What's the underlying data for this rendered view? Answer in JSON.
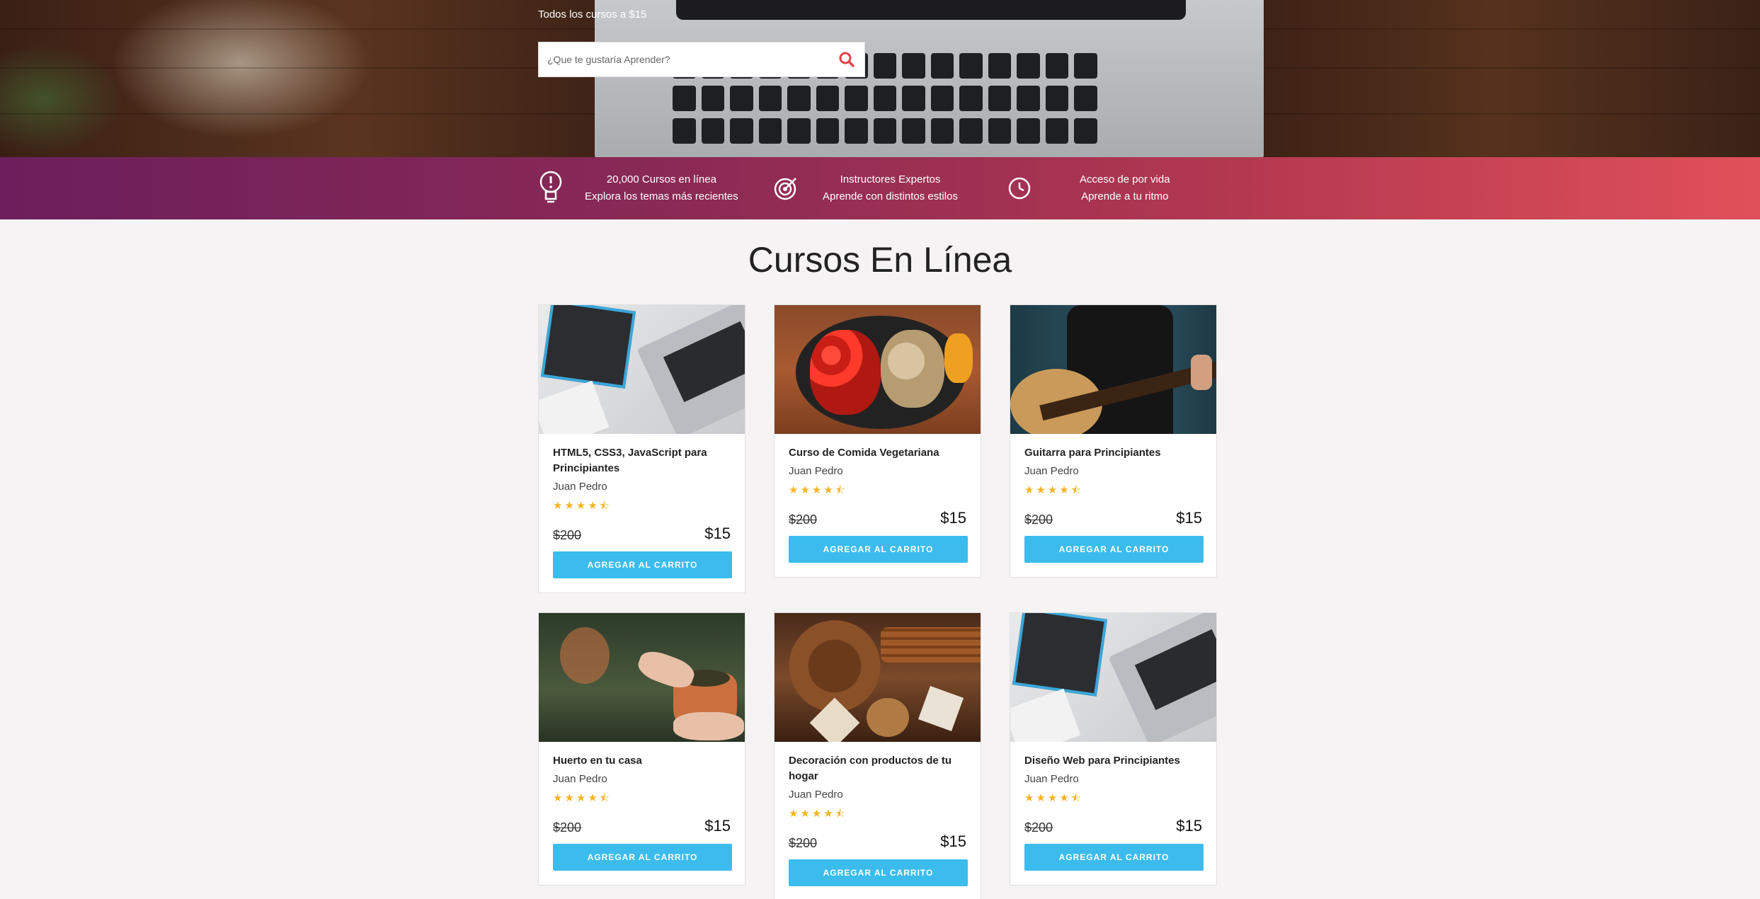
{
  "hero": {
    "promo": "Todos los cursos a $15",
    "search_placeholder": "¿Que te gustaría Aprender?"
  },
  "features": [
    {
      "icon": "lightbulb-icon",
      "line1": "20,000 Cursos en línea",
      "line2": "Explora los temas más recientes"
    },
    {
      "icon": "target-icon",
      "line1": "Instructores Expertos",
      "line2": "Aprende con distintos estilos"
    },
    {
      "icon": "clock-icon",
      "line1": "Acceso de por vida",
      "line2": "Aprende a tu ritmo"
    }
  ],
  "section_title": "Cursos En Línea",
  "colors": {
    "button": "#3bbced",
    "stars": "#f5b324",
    "bar_start": "#6c1f5c",
    "bar_end": "#e0505a",
    "search_icon": "#e2434b"
  },
  "courses": [
    {
      "image": "laptop-notebook-image",
      "title": "HTML5, CSS3, JavaScript para Principiantes",
      "author": "Juan Pedro",
      "rating": 4.5,
      "old_price": "$200",
      "price": "$15",
      "button": "AGREGAR AL CARRITO"
    },
    {
      "image": "vegetables-pan-image",
      "title": "Curso de Comida Vegetariana",
      "author": "Juan Pedro",
      "rating": 4.5,
      "old_price": "$200",
      "price": "$15",
      "button": "AGREGAR AL CARRITO"
    },
    {
      "image": "guitar-player-image",
      "title": "Guitarra para Principiantes",
      "author": "Juan Pedro",
      "rating": 4.5,
      "old_price": "$200",
      "price": "$15",
      "button": "AGREGAR AL CARRITO"
    },
    {
      "image": "plant-pot-image",
      "title": "Huerto en tu casa",
      "author": "Juan Pedro",
      "rating": 4.5,
      "old_price": "$200",
      "price": "$15",
      "button": "AGREGAR AL CARRITO"
    },
    {
      "image": "pinecone-cinnamon-image",
      "title": "Decoración con productos de tu hogar",
      "author": "Juan Pedro",
      "rating": 4.5,
      "old_price": "$200",
      "price": "$15",
      "button": "AGREGAR AL CARRITO"
    },
    {
      "image": "laptop-notebook-image",
      "title": "Diseño Web para Principiantes",
      "author": "Juan Pedro",
      "rating": 4.5,
      "old_price": "$200",
      "price": "$15",
      "button": "AGREGAR AL CARRITO"
    }
  ]
}
